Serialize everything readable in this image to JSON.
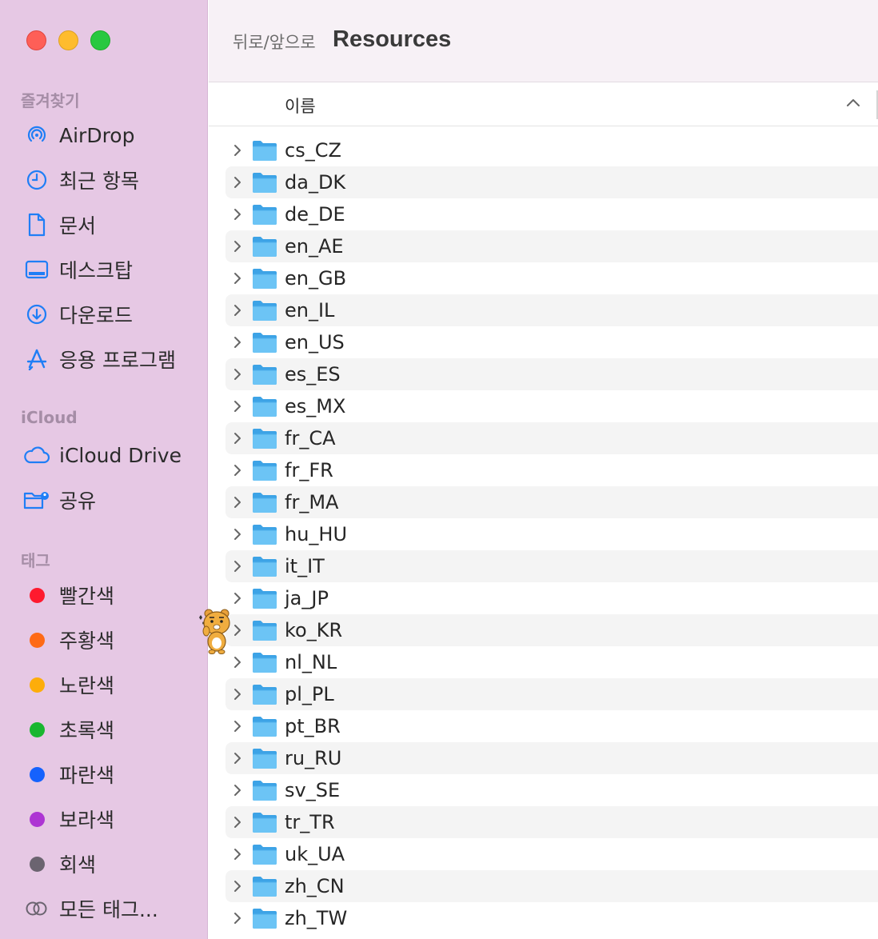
{
  "window": {
    "controls": [
      "close",
      "minimize",
      "zoom"
    ],
    "colors": {
      "close": "#fe5f57",
      "minimize": "#febc2e",
      "zoom": "#28c840",
      "sidebar_bg": "#e6c8e4",
      "folder": "#5ab8f0"
    }
  },
  "toolbar": {
    "nav_label": "뒤로/앞으로",
    "title": "Resources"
  },
  "sidebar": {
    "favorites": {
      "title": "즐겨찾기",
      "items": [
        {
          "label": "AirDrop",
          "icon": "airdrop-icon"
        },
        {
          "label": "최근 항목",
          "icon": "clock-icon"
        },
        {
          "label": "문서",
          "icon": "document-icon"
        },
        {
          "label": "데스크탑",
          "icon": "desktop-icon"
        },
        {
          "label": "다운로드",
          "icon": "download-icon"
        },
        {
          "label": "응용 프로그램",
          "icon": "applications-icon"
        }
      ]
    },
    "icloud": {
      "title": "iCloud",
      "items": [
        {
          "label": "iCloud Drive",
          "icon": "cloud-icon"
        },
        {
          "label": "공유",
          "icon": "shared-folder-icon"
        }
      ]
    },
    "tags": {
      "title": "태그",
      "items": [
        {
          "label": "빨간색",
          "color": "#fe1a2e"
        },
        {
          "label": "주황색",
          "color": "#fe6a15"
        },
        {
          "label": "노란색",
          "color": "#fdad0a"
        },
        {
          "label": "초록색",
          "color": "#19b62f"
        },
        {
          "label": "파란색",
          "color": "#1562fd"
        },
        {
          "label": "보라색",
          "color": "#ad35d3"
        },
        {
          "label": "회색",
          "color": "#6b6470"
        },
        {
          "label": "모든 태그...",
          "icon": "all-tags-icon"
        }
      ]
    }
  },
  "list": {
    "column_header": "이름",
    "sort": "ascending",
    "rows": [
      "cs_CZ",
      "da_DK",
      "de_DE",
      "en_AE",
      "en_GB",
      "en_IL",
      "en_US",
      "es_ES",
      "es_MX",
      "fr_CA",
      "fr_FR",
      "fr_MA",
      "hu_HU",
      "it_IT",
      "ja_JP",
      "ko_KR",
      "nl_NL",
      "pl_PL",
      "pt_BR",
      "ru_RU",
      "sv_SE",
      "tr_TR",
      "uk_UA",
      "zh_CN",
      "zh_TW"
    ]
  }
}
